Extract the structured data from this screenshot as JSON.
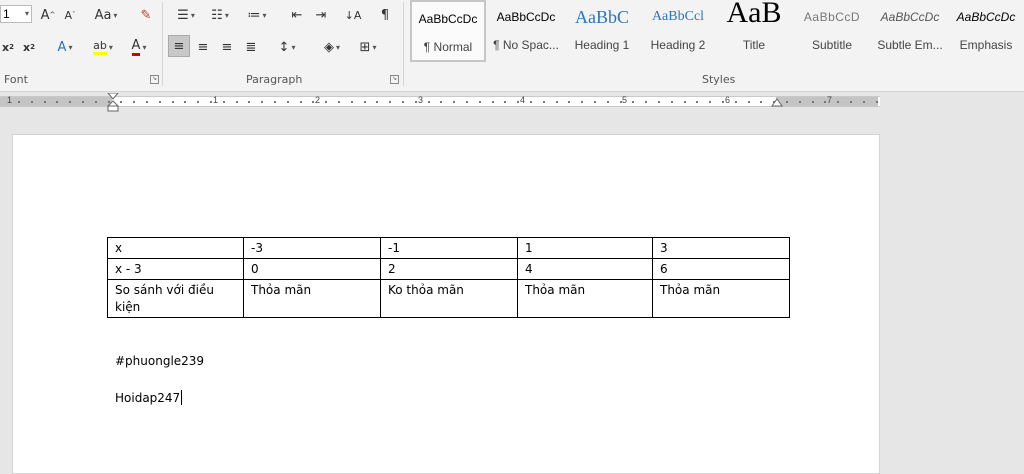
{
  "ribbon": {
    "font_size_value": "1",
    "font_group_label": "Font",
    "paragraph_group_label": "Paragraph",
    "styles_group_label": "Styles",
    "styles": [
      {
        "preview": "AaBbCcDc",
        "name": "¶ Normal",
        "active": true
      },
      {
        "preview": "AaBbCcDc",
        "name": "¶ No Spac..."
      },
      {
        "preview": "AaBbC",
        "name": "Heading 1"
      },
      {
        "preview": "AaBbCcl",
        "name": "Heading 2"
      },
      {
        "preview": "AaB",
        "name": "Title"
      },
      {
        "preview": "AaBbCcD",
        "name": "Subtitle"
      },
      {
        "preview": "AaBbCcDc",
        "name": "Subtle Em..."
      },
      {
        "preview": "AaBbCcDc",
        "name": "Emphasis"
      }
    ],
    "colors": {
      "heading_blue": "#2e74b5",
      "highlight_yellow": "#ffff00",
      "font_red": "#d00000"
    }
  },
  "ruler": {
    "numbers": [
      "1",
      "1",
      "2",
      "3",
      "4",
      "5",
      "6",
      "7"
    ]
  },
  "document": {
    "table": {
      "rows": [
        [
          "x",
          "-3",
          "-1",
          "1",
          "3"
        ],
        [
          "x - 3",
          "0",
          "2",
          "4",
          "6"
        ],
        [
          "So sánh với điều kiện",
          "Thỏa mãn",
          "Ko thỏa mãn",
          "Thỏa mãn",
          "Thỏa mãn"
        ]
      ]
    },
    "paragraphs": [
      "#phuongle239",
      "Hoidap247"
    ]
  }
}
